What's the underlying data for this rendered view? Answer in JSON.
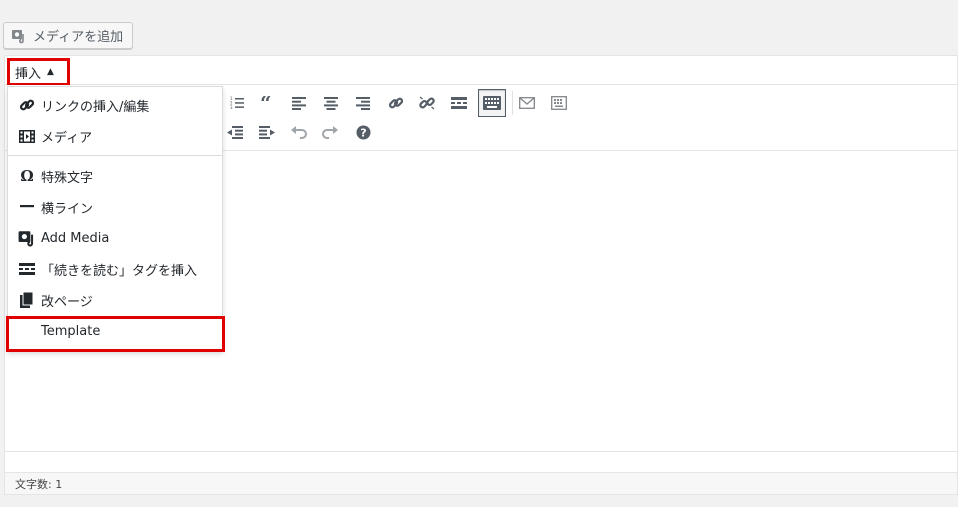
{
  "media_button": {
    "label": "メディアを追加",
    "icon": "add-media-icon"
  },
  "menubar": {
    "insert_label": "挿入",
    "caret": "▲"
  },
  "insert_menu": {
    "items": [
      {
        "label": "リンクの挿入/編集",
        "icon": "link-icon"
      },
      {
        "label": "メディア",
        "icon": "film-icon"
      },
      {
        "label": "特殊文字",
        "icon": "omega-icon"
      },
      {
        "label": "横ライン",
        "icon": "horizontal-line-icon"
      },
      {
        "label": "Add Media",
        "icon": "add-media-icon"
      },
      {
        "label": "「続きを読む」タグを挿入",
        "icon": "read-more-icon"
      },
      {
        "label": "改ページ",
        "icon": "page-break-icon"
      },
      {
        "label": "Template",
        "icon": ""
      }
    ]
  },
  "toolbar": {
    "row1": [
      "ordered-list-icon",
      "blockquote-icon",
      "align-left-icon",
      "align-center-icon",
      "align-right-icon",
      "link-icon",
      "unlink-icon",
      "read-more-icon",
      "toolbar-toggle-icon",
      "email-icon",
      "fullscreen-icon"
    ],
    "row2": [
      "outdent-icon",
      "indent-icon",
      "undo-icon",
      "redo-icon",
      "help-icon"
    ]
  },
  "statusbar": {
    "word_count": "文字数: 1"
  },
  "colors": {
    "highlight": "#e00000",
    "text": "#23282d",
    "icon": "#555d66"
  }
}
